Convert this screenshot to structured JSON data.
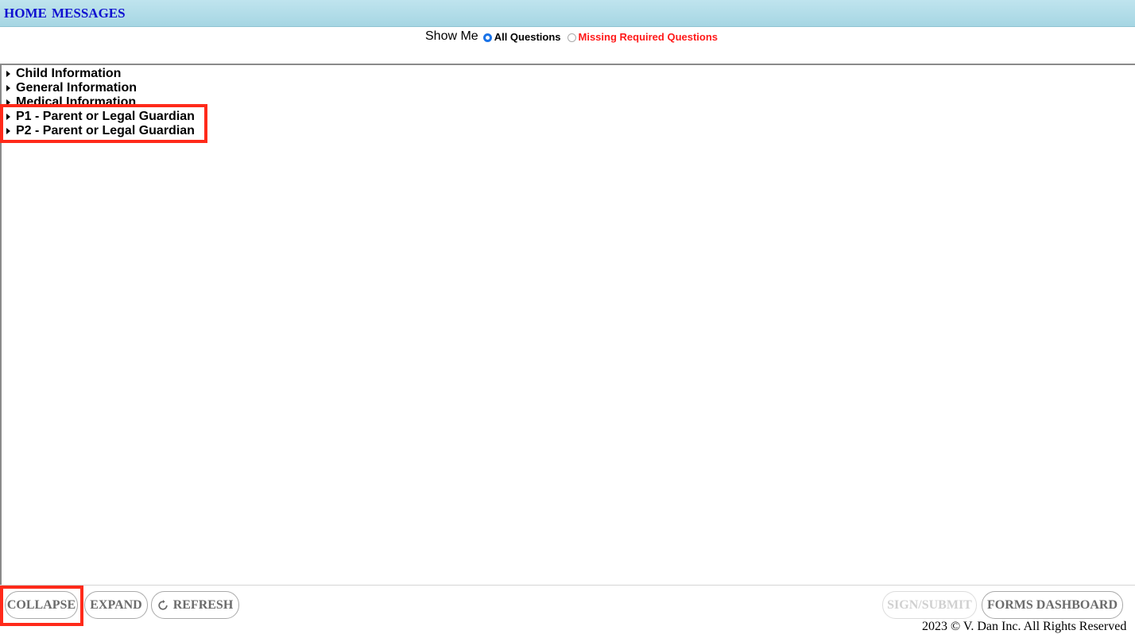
{
  "nav": {
    "home": "HOME",
    "messages": "MESSAGES"
  },
  "filter": {
    "label": "Show Me",
    "options": [
      {
        "label": "All Questions",
        "selected": true,
        "color": "#000000"
      },
      {
        "label": "Missing Required Questions",
        "selected": false,
        "color": "#ff1a1a"
      }
    ]
  },
  "tree": {
    "sections": [
      {
        "label": "Child Information"
      },
      {
        "label": "General Information"
      },
      {
        "label": "Medical Information"
      },
      {
        "label": "P1 - Parent or Legal Guardian"
      },
      {
        "label": "P2 - Parent or Legal Guardian"
      }
    ]
  },
  "footer": {
    "collapse": "COLLAPSE",
    "expand": "EXPAND",
    "refresh": "REFRESH",
    "sign_submit": "SIGN/SUBMIT",
    "forms_dashboard": "FORMS DASHBOARD",
    "copyright": "2023 © V. Dan Inc. All Rights Reserved"
  },
  "colors": {
    "nav_link": "#1010d0",
    "highlight": "#ff2a1a",
    "radio_selected": "#1a73e8"
  }
}
